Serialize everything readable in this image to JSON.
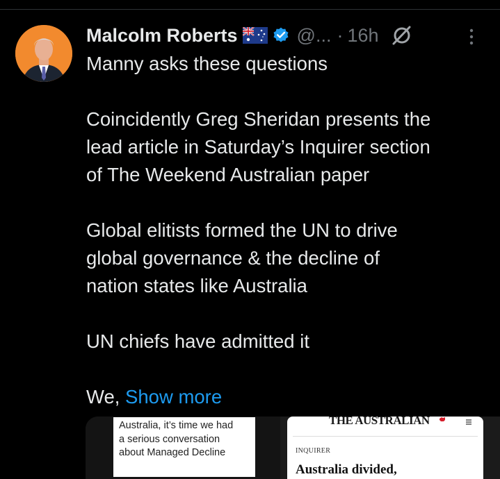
{
  "colors": {
    "background": "#000000",
    "text": "#e7e9ea",
    "secondary": "#71767b",
    "link": "#1d9bf0",
    "verified": "#1d9bf0",
    "avatar_bg": "#f28a2e"
  },
  "tweet": {
    "author_name": "Malcolm Roberts",
    "flag_icon": "australia-flag-icon",
    "verified_icon": "verified-badge-icon",
    "handle": "@...",
    "separator": "·",
    "timestamp": "16h",
    "grok_icon": "grok-icon",
    "more_icon": "more-vertical-icon",
    "body": {
      "p1": "Manny asks these questions",
      "p2": [
        "Coincidently Greg Sheridan presents the",
        "lead article in Saturday’s Inquirer section",
        "of The Weekend Australian paper"
      ],
      "p3": [
        "Global elitists formed the UN to drive",
        "global governance & the decline of",
        "nation states like Australia"
      ],
      "p4": "UN chiefs have admitted it",
      "p5_prefix": "We, ",
      "show_more": "Show more"
    }
  },
  "media": {
    "left_card": [
      "Australia, it’s time we had",
      "a serious conversation",
      "about Managed Decline"
    ],
    "right_card": {
      "brand": "THE AUSTRALIAN",
      "section": "INQUIRER",
      "headline": "Australia divided,"
    }
  }
}
